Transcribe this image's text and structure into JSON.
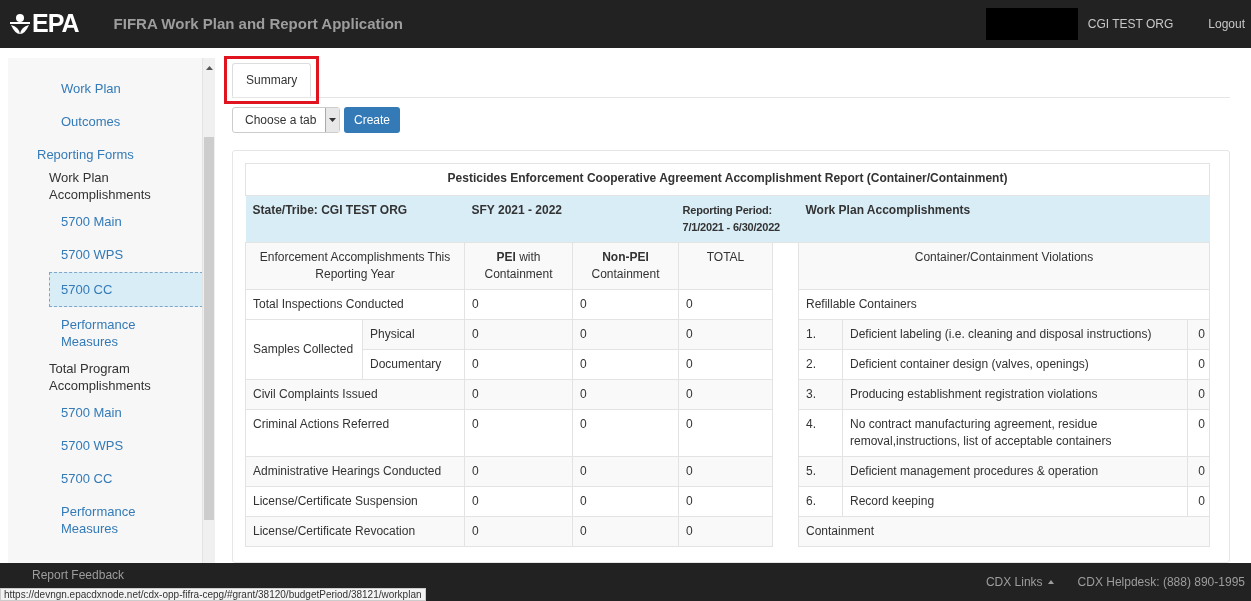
{
  "header": {
    "logo_text": "EPA",
    "title": "FIFRA Work Plan and Report Application",
    "org": "CGI TEST ORG",
    "logout": "Logout"
  },
  "sidebar": {
    "items": [
      {
        "label": "Work Plan",
        "kind": "link",
        "selected": false
      },
      {
        "label": "Outcomes",
        "kind": "link",
        "selected": false
      },
      {
        "label": "Reporting Forms",
        "kind": "section",
        "selected": false,
        "children": [
          {
            "label": "Work Plan Accomplishments",
            "kind": "group",
            "selected": false,
            "children": [
              {
                "label": "5700 Main",
                "kind": "link",
                "selected": false
              },
              {
                "label": "5700 WPS",
                "kind": "link",
                "selected": false
              },
              {
                "label": "5700 CC",
                "kind": "link",
                "selected": true
              },
              {
                "label": "Performance Measures",
                "kind": "link",
                "selected": false
              }
            ]
          },
          {
            "label": "Total Program Accomplishments",
            "kind": "group",
            "selected": false,
            "children": [
              {
                "label": "5700 Main",
                "kind": "link",
                "selected": false
              },
              {
                "label": "5700 WPS",
                "kind": "link",
                "selected": false
              },
              {
                "label": "5700 CC",
                "kind": "link",
                "selected": false
              },
              {
                "label": "Performance Measures",
                "kind": "link",
                "selected": false
              }
            ]
          }
        ]
      }
    ]
  },
  "tabs": [
    {
      "label": "Summary",
      "selected": true,
      "highlighted": true
    }
  ],
  "toolbar": {
    "select": {
      "placeholder": "Choose a tab"
    },
    "button": "Create"
  },
  "report": {
    "title": "Pesticides Enforcement Cooperative Agreement Accomplishment Report (Container/Containment)",
    "header": {
      "state": "State/Tribe: CGI TEST ORG",
      "year": "SFY 2021 - 2022",
      "period": "Reporting Period: 7/1/2021 - 6/30/2022",
      "section": "Work Plan Accomplishments"
    },
    "columns": [
      "Enforcement Accomplishments This Reporting Year",
      "**PEI** with Containment",
      "**Non-PEI** Containment",
      "TOTAL"
    ],
    "violations_heading": "Container/Containment Violations",
    "left_rows": [
      {
        "label": "Total Inspections Conducted",
        "values": [
          "0",
          "0",
          "0"
        ]
      },
      {
        "label": "Samples Collected",
        "children": [
          {
            "label": "Physical",
            "values": [
              "0",
              "0",
              "0"
            ]
          },
          {
            "label": "Documentary",
            "values": [
              "0",
              "0",
              "0"
            ]
          }
        ]
      },
      {
        "label": "Civil Complaints Issued",
        "values": [
          "0",
          "0",
          "0"
        ]
      },
      {
        "label": "Criminal Actions Referred",
        "values": [
          "0",
          "0",
          "0"
        ]
      },
      {
        "label": "Administrative Hearings Conducted",
        "values": [
          "0",
          "0",
          "0"
        ]
      },
      {
        "label": "License/Certificate Suspension",
        "values": [
          "0",
          "0",
          "0"
        ]
      },
      {
        "label": "License/Certificate Revocation",
        "values": [
          "0",
          "0",
          "0"
        ]
      }
    ],
    "right_rows": [
      {
        "kind": "section",
        "label": "Refillable Containers"
      },
      {
        "kind": "item",
        "number": "1.",
        "label": "Deficient labeling (i.e. cleaning and disposal instructions)",
        "value": "0"
      },
      {
        "kind": "item",
        "number": "2.",
        "label": "Deficient container design (valves, openings)",
        "value": "0"
      },
      {
        "kind": "item",
        "number": "3.",
        "label": "Producing establishment registration violations",
        "value": "0"
      },
      {
        "kind": "item",
        "number": "4.",
        "label": "No contract manufacturing agreement, residue removal,instructions, list of acceptable containers",
        "value": "0"
      },
      {
        "kind": "item",
        "number": "5.",
        "label": "Deficient management procedures & operation",
        "value": "0"
      },
      {
        "kind": "item",
        "number": "6.",
        "label": "Record keeping",
        "value": "0"
      },
      {
        "kind": "section",
        "label": "Containment"
      }
    ]
  },
  "footer": {
    "feedback": "Report Feedback",
    "links": "CDX Links",
    "helpdesk": "CDX Helpdesk: (888) 890-1995"
  },
  "status_url": "https://devngn.epacdxnode.net/cdx-opp-fifra-cepg/#grant/38120/budgetPeriod/38121/workplan"
}
